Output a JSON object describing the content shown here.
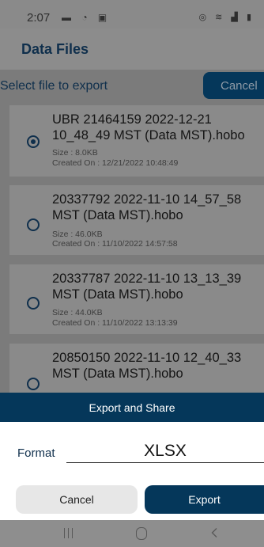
{
  "status_bar": {
    "time": "2:07",
    "left_icons": [
      "message-icon",
      "wifi-calling-icon",
      "gallery-icon"
    ],
    "left_glyphs": "▬ ◔ ▣",
    "right_icons": [
      "alarm-icon",
      "wifi-icon",
      "signal-icon",
      "battery-icon"
    ],
    "right_glyphs": "◎ ≋ ▟ ▮"
  },
  "header": {
    "title": "Data Files"
  },
  "list": {
    "prompt": "Select file to export",
    "cancel_label": "Cancel",
    "files": [
      {
        "name": "UBR 21464159 2022-12-21 10_48_49 MST (Data MST).hobo",
        "size": "Size : 8.0KB",
        "created": "Created On : 12/21/2022 10:48:49",
        "selected": true
      },
      {
        "name": "20337792 2022-11-10 14_57_58 MST (Data MST).hobo",
        "size": "Size : 46.0KB",
        "created": "Created On : 11/10/2022 14:57:58",
        "selected": false
      },
      {
        "name": "20337787 2022-11-10 13_13_39 MST (Data MST).hobo",
        "size": "Size : 44.0KB",
        "created": "Created On : 11/10/2022 13:13:39",
        "selected": false
      },
      {
        "name": "20850150 2022-11-10 12_40_33 MST (Data MST).hobo",
        "size": "",
        "created": "",
        "selected": false
      }
    ]
  },
  "sheet": {
    "title": "Export and Share",
    "format_label": "Format",
    "format_value": "XLSX",
    "cancel_label": "Cancel",
    "export_label": "Export"
  },
  "nav": {
    "recent_icon": "recent-apps-icon",
    "home_icon": "home-icon",
    "back_icon": "back-icon"
  },
  "colors": {
    "accent": "#05375a",
    "title_text": "#0f2f4c",
    "dim_overlay": "#8f8f8f",
    "cancel_button_bg": "#e7e7e7"
  }
}
